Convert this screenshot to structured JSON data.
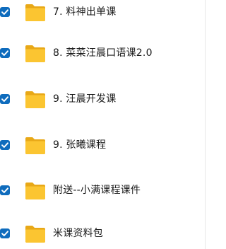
{
  "file_list": {
    "items": [
      {
        "name": "7. 料神出单课",
        "checked": true,
        "icon": "folder-icon"
      },
      {
        "name": "8. 菜菜汪晨口语课2.0",
        "checked": true,
        "icon": "folder-icon"
      },
      {
        "name": "9. 汪晨开发课",
        "checked": true,
        "icon": "folder-icon"
      },
      {
        "name": "9. 张曦课程",
        "checked": true,
        "icon": "folder-icon"
      },
      {
        "name": "附送--小满课程课件",
        "checked": true,
        "icon": "folder-icon"
      },
      {
        "name": "米课资料包",
        "checked": true,
        "icon": "folder-icon"
      }
    ]
  },
  "colors": {
    "checkbox": "#0f6cbd",
    "folder_back": "#e8a817",
    "folder_front": "#fbc531"
  }
}
